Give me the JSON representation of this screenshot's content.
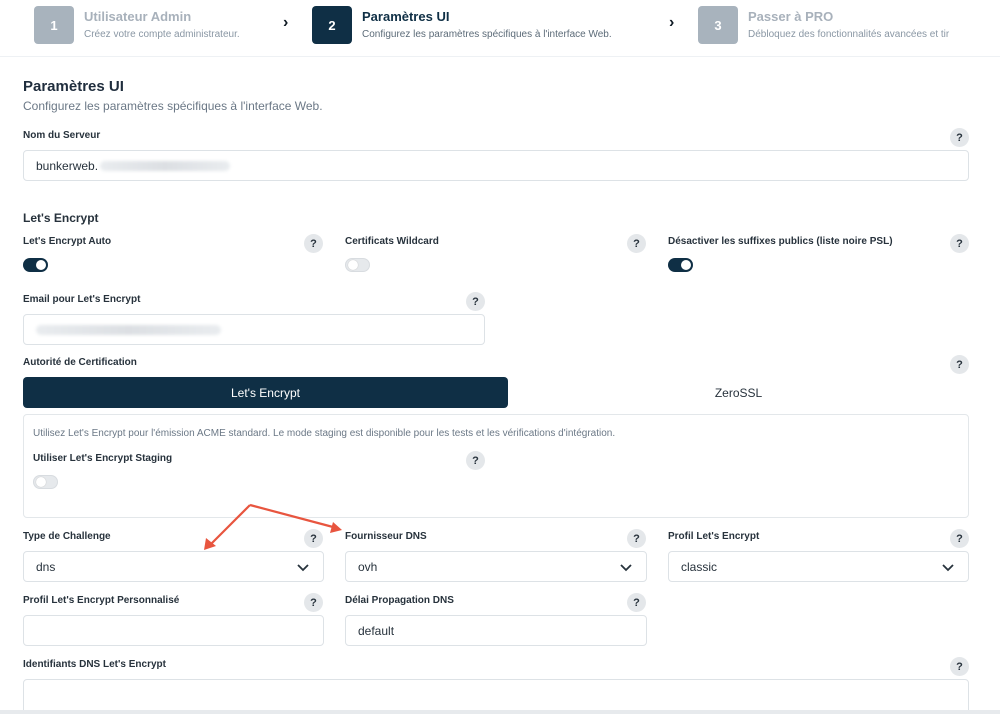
{
  "stepper": {
    "steps": [
      {
        "num": "1",
        "title": "Utilisateur Admin",
        "sub": "Créez votre compte administrateur."
      },
      {
        "num": "2",
        "title": "Paramètres UI",
        "sub": "Configurez les paramètres spécifiques à l'interface Web."
      },
      {
        "num": "3",
        "title": "Passer à PRO",
        "sub": "Débloquez des fonctionnalités avancées et tir"
      }
    ],
    "separator": "›"
  },
  "page": {
    "title": "Paramètres UI",
    "subtitle": "Configurez les paramètres spécifiques à l'interface Web."
  },
  "server": {
    "label": "Nom du Serveur",
    "value_prefix": "bunkerweb."
  },
  "letsencrypt": {
    "section_title": "Let's Encrypt",
    "auto_label": "Let's Encrypt Auto",
    "auto_on": true,
    "wildcard_label": "Certificats Wildcard",
    "wildcard_on": false,
    "psl_label": "Désactiver les suffixes publics (liste noire PSL)",
    "psl_on": true,
    "email_label": "Email pour Let's Encrypt",
    "ca_label": "Autorité de Certification",
    "ca_options": [
      "Let's Encrypt",
      "ZeroSSL"
    ],
    "ca_selected": "Let's Encrypt",
    "panel_desc": "Utilisez Let's Encrypt pour l'émission ACME standard. Le mode staging est disponible pour les tests et les vérifications d'intégration.",
    "staging_label": "Utiliser Let's Encrypt Staging",
    "staging_on": false,
    "challenge_label": "Type de Challenge",
    "challenge_value": "dns",
    "dns_provider_label": "Fournisseur DNS",
    "dns_provider_value": "ovh",
    "profile_label": "Profil Let's Encrypt",
    "profile_value": "classic",
    "custom_profile_label": "Profil Let's Encrypt Personnalisé",
    "custom_profile_value": "",
    "propagation_label": "Délai Propagation DNS",
    "propagation_value": "default",
    "dns_credentials_label": "Identifiants DNS Let's Encrypt"
  },
  "help_glyph": "?",
  "colors": {
    "primary": "#0f2f45",
    "step_inactive": "#a8b3bd",
    "annotation_arrow": "#e8553f"
  }
}
